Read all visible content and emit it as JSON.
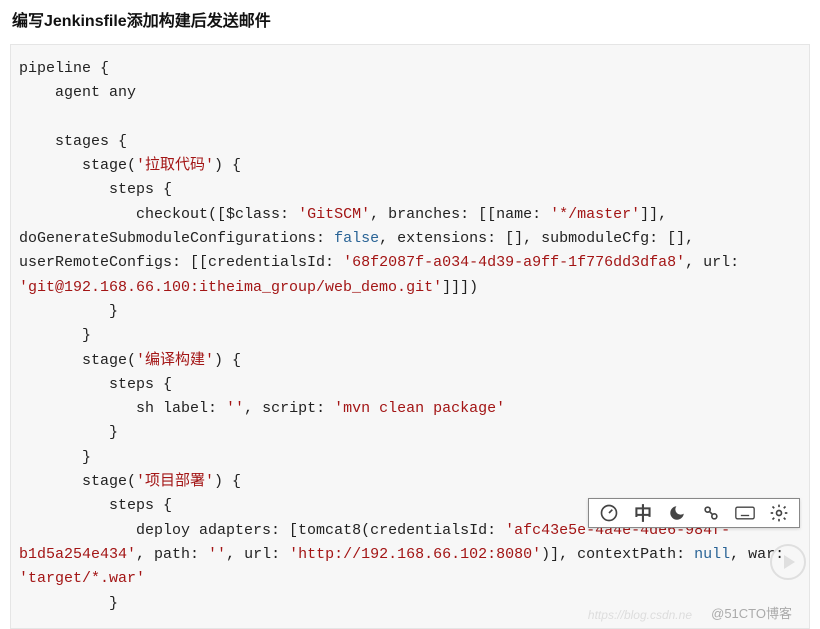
{
  "title": "编写Jenkinsfile添加构建后发送邮件",
  "code": {
    "l1": "pipeline {",
    "l2": "    agent any",
    "l3": "",
    "l4": "    stages {",
    "l5a": "       stage(",
    "l5s": "'拉取代码'",
    "l5b": ") {",
    "l6": "          steps {",
    "l7a": "             checkout([$class: ",
    "l7s1": "'GitSCM'",
    "l7b": ", branches: [[name: ",
    "l7s2": "'*/master'",
    "l7c": "]],",
    "l8a": "doGenerateSubmoduleConfigurations: ",
    "l8f": "false",
    "l8b": ", extensions: [], submoduleCfg: [],",
    "l9a": "userRemoteConfigs: [[credentialsId: ",
    "l9s1": "'68f2087f-a034-4d39-a9ff-1f776dd3dfa8'",
    "l9b": ", url:",
    "l10s": "'git@192.168.66.100:itheima_group/web_demo.git'",
    "l10b": "]]])",
    "l11": "          }",
    "l12": "       }",
    "l13a": "       stage(",
    "l13s": "'编译构建'",
    "l13b": ") {",
    "l14": "          steps {",
    "l15a": "             sh label: ",
    "l15s1": "''",
    "l15b": ", script: ",
    "l15s2": "'mvn clean package'",
    "l16": "          }",
    "l17": "       }",
    "l18a": "       stage(",
    "l18s": "'项目部署'",
    "l18b": ") {",
    "l19": "          steps {",
    "l20a": "             deploy adapters: [tomcat8(credentialsId: ",
    "l20s1": "'afc43e5e-4a4e-4de6-984f-b1d5a254e434'",
    "l20b": ", path: ",
    "l20s2": "''",
    "l20c": ", url: ",
    "l20s3": "'http://192.168.66.102:8080'",
    "l20d": ")], contextPath: ",
    "l20n": "null",
    "l20e": ", war:",
    "l21s": "'target/*.war'",
    "l22": "          }"
  },
  "toolbar": {
    "i1": "gauge-icon",
    "i2": "中",
    "i3": "moon-icon",
    "i4": "link-icon",
    "i5": "keyboard-icon",
    "i6": "gear-icon"
  },
  "watermark": "@51CTO博客",
  "watermark2": "https://blog.csdn.ne"
}
